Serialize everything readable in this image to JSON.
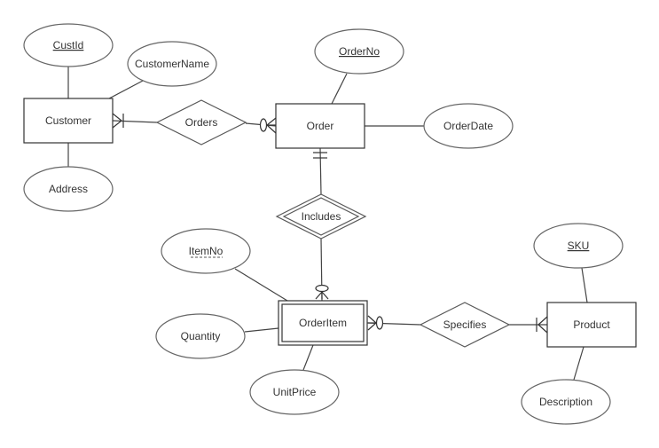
{
  "diagram": {
    "type": "er-diagram",
    "notation": "crow's foot",
    "entities": [
      {
        "id": "customer",
        "label": "Customer",
        "weak": false
      },
      {
        "id": "order",
        "label": "Order",
        "weak": false
      },
      {
        "id": "orderitem",
        "label": "OrderItem",
        "weak": true
      },
      {
        "id": "product",
        "label": "Product",
        "weak": false
      }
    ],
    "relationships": [
      {
        "id": "orders",
        "label": "Orders",
        "identifying": false
      },
      {
        "id": "includes",
        "label": "Includes",
        "identifying": true
      },
      {
        "id": "specifies",
        "label": "Specifies",
        "identifying": false
      }
    ],
    "attributes": [
      {
        "id": "custid",
        "label": "CustId",
        "entity": "customer",
        "key": "primary"
      },
      {
        "id": "customername",
        "label": "CustomerName",
        "entity": "customer",
        "key": "none"
      },
      {
        "id": "address",
        "label": "Address",
        "entity": "customer",
        "key": "none"
      },
      {
        "id": "orderno",
        "label": "OrderNo",
        "entity": "order",
        "key": "primary"
      },
      {
        "id": "orderdate",
        "label": "OrderDate",
        "entity": "order",
        "key": "none"
      },
      {
        "id": "itemno",
        "label": "ItemNo",
        "entity": "orderitem",
        "key": "partial"
      },
      {
        "id": "quantity",
        "label": "Quantity",
        "entity": "orderitem",
        "key": "none"
      },
      {
        "id": "unitprice",
        "label": "UnitPrice",
        "entity": "orderitem",
        "key": "none"
      },
      {
        "id": "sku",
        "label": "SKU",
        "entity": "product",
        "key": "primary"
      },
      {
        "id": "description",
        "label": "Description",
        "entity": "product",
        "key": "none"
      }
    ],
    "links": [
      {
        "from": "customer",
        "to": "orders",
        "cardinality_at_entity": "one-or-many"
      },
      {
        "from": "orders",
        "to": "order",
        "cardinality_at_entity": "zero-or-many"
      },
      {
        "from": "order",
        "to": "includes",
        "cardinality_at_entity": "one-and-only-one"
      },
      {
        "from": "includes",
        "to": "orderitem",
        "cardinality_at_entity": "zero-or-many"
      },
      {
        "from": "orderitem",
        "to": "specifies",
        "cardinality_at_entity": "zero-or-many"
      },
      {
        "from": "specifies",
        "to": "product",
        "cardinality_at_entity": "one-or-many"
      }
    ],
    "colors": {
      "background": "#ffffff",
      "stroke": "#333333",
      "text": "#333333"
    }
  }
}
